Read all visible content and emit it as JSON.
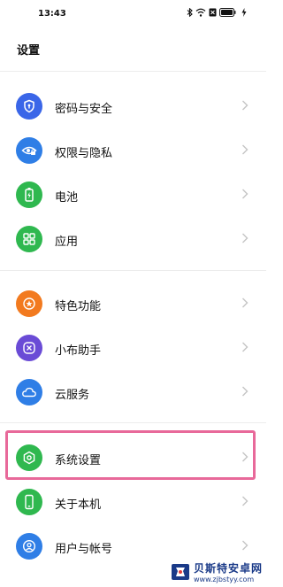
{
  "status_bar": {
    "time": "13:43"
  },
  "page": {
    "title": "设置"
  },
  "settings": [
    {
      "label": "密码与安全",
      "icon": "shield-lock-icon",
      "color": "#3a66e8"
    },
    {
      "label": "权限与隐私",
      "icon": "eye-lock-icon",
      "color": "#2f7ee6"
    },
    {
      "label": "电池",
      "icon": "battery-icon",
      "color": "#2fb84f"
    },
    {
      "label": "应用",
      "icon": "grid-apps-icon",
      "color": "#2fb84f"
    },
    {
      "label": "特色功能",
      "icon": "star-badge-icon",
      "color": "#f27a1f"
    },
    {
      "label": "小布助手",
      "icon": "assistant-icon",
      "color": "#6a4bd6"
    },
    {
      "label": "云服务",
      "icon": "cloud-icon",
      "color": "#2f7ee6"
    },
    {
      "label": "系统设置",
      "icon": "gear-icon",
      "color": "#2fb84f"
    },
    {
      "label": "关于本机",
      "icon": "phone-icon",
      "color": "#2fb84f"
    },
    {
      "label": "用户与帐号",
      "icon": "user-icon",
      "color": "#2f7ee6"
    }
  ],
  "watermark": {
    "title": "贝斯特安卓网",
    "url": "www.zjbstyy.com"
  }
}
